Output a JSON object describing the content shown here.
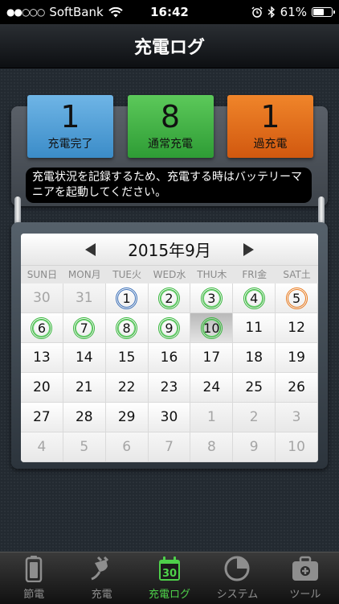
{
  "status": {
    "carrier": "SoftBank",
    "signal_dots": "●●○○○",
    "time": "16:42",
    "battery_percent": "61%",
    "battery_level": 0.61
  },
  "nav": {
    "title": "充電ログ"
  },
  "counters": [
    {
      "value": "1",
      "label": "充電完了",
      "color": "#4a9fd8"
    },
    {
      "value": "8",
      "label": "通常充電",
      "color": "#3cb043"
    },
    {
      "value": "1",
      "label": "過充電",
      "color": "#e66b1c"
    }
  ],
  "note": "充電状況を記録するため、充電する時はバッテリーマニアを起動してください。",
  "calendar": {
    "month": "2015年9月",
    "weekdays": [
      "SUN日",
      "MON月",
      "TUE火",
      "WED水",
      "THU木",
      "FRI金",
      "SAT土"
    ],
    "days": [
      {
        "d": "30",
        "o": true
      },
      {
        "d": "31",
        "o": true
      },
      {
        "d": "1",
        "r": "blue"
      },
      {
        "d": "2",
        "r": "green"
      },
      {
        "d": "3",
        "r": "green"
      },
      {
        "d": "4",
        "r": "green"
      },
      {
        "d": "5",
        "r": "orange"
      },
      {
        "d": "6",
        "r": "green"
      },
      {
        "d": "7",
        "r": "green"
      },
      {
        "d": "8",
        "r": "green"
      },
      {
        "d": "9",
        "r": "green"
      },
      {
        "d": "10",
        "r": "green",
        "t": true
      },
      {
        "d": "11"
      },
      {
        "d": "12"
      },
      {
        "d": "13"
      },
      {
        "d": "14"
      },
      {
        "d": "15"
      },
      {
        "d": "16"
      },
      {
        "d": "17"
      },
      {
        "d": "18"
      },
      {
        "d": "19"
      },
      {
        "d": "20"
      },
      {
        "d": "21"
      },
      {
        "d": "22"
      },
      {
        "d": "23"
      },
      {
        "d": "24"
      },
      {
        "d": "25"
      },
      {
        "d": "26"
      },
      {
        "d": "27"
      },
      {
        "d": "28"
      },
      {
        "d": "29"
      },
      {
        "d": "30"
      },
      {
        "d": "1",
        "o": true
      },
      {
        "d": "2",
        "o": true
      },
      {
        "d": "3",
        "o": true
      },
      {
        "d": "4",
        "o": true
      },
      {
        "d": "5",
        "o": true
      },
      {
        "d": "6",
        "o": true
      },
      {
        "d": "7",
        "o": true
      },
      {
        "d": "8",
        "o": true
      },
      {
        "d": "9",
        "o": true
      },
      {
        "d": "10",
        "o": true
      }
    ]
  },
  "tabs": [
    {
      "label": "節電",
      "icon": "battery-icon",
      "active": false
    },
    {
      "label": "充電",
      "icon": "plug-icon",
      "active": false
    },
    {
      "label": "充電ログ",
      "icon": "calendar-icon",
      "active": true,
      "badge": "30"
    },
    {
      "label": "システム",
      "icon": "pie-chart-icon",
      "active": false
    },
    {
      "label": "ツール",
      "icon": "toolbox-icon",
      "active": false
    }
  ],
  "colors": {
    "accent_green": "#4ed04a"
  }
}
